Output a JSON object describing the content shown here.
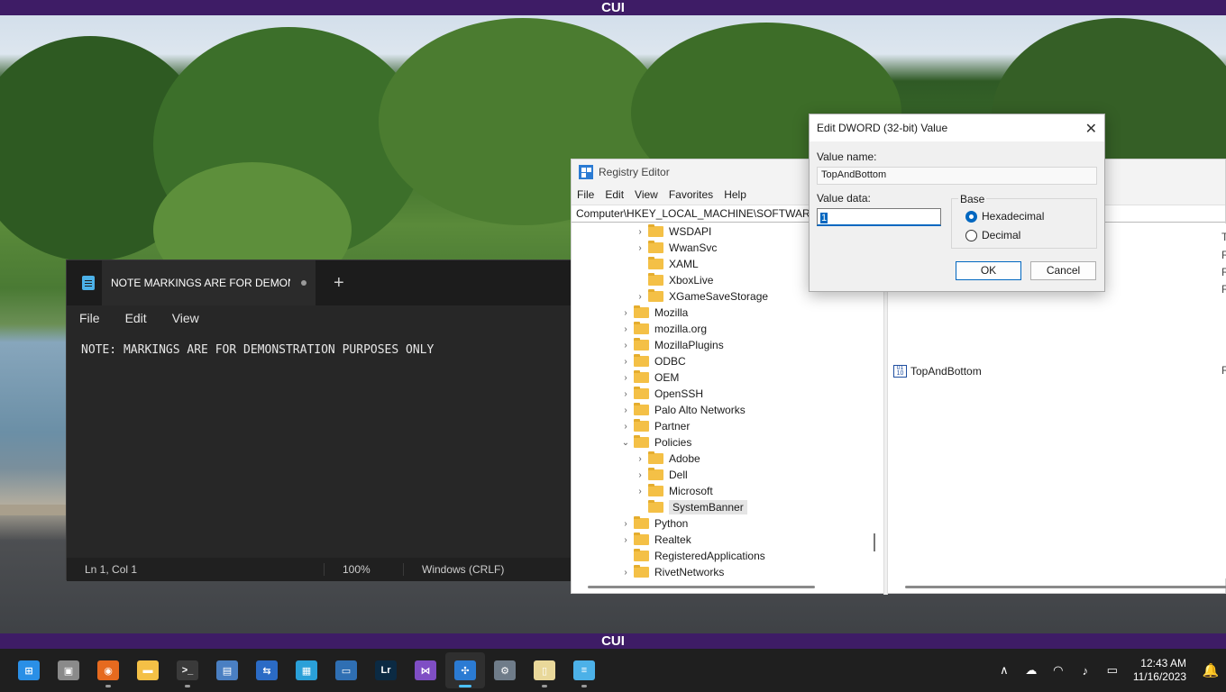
{
  "banner": {
    "top_text": "CUI",
    "bottom_text": "CUI"
  },
  "notepad": {
    "tab_title": "NOTE MARKINGS ARE FOR DEMON",
    "new_tab": "+",
    "menu": [
      "File",
      "Edit",
      "View"
    ],
    "content": "NOTE: MARKINGS ARE FOR DEMONSTRATION PURPOSES ONLY",
    "status": {
      "position": "Ln 1, Col 1",
      "zoom": "100%",
      "line_ending": "Windows (CRLF)"
    }
  },
  "regedit": {
    "title": "Registry Editor",
    "menu": [
      "File",
      "Edit",
      "View",
      "Favorites",
      "Help"
    ],
    "address": "Computer\\HKEY_LOCAL_MACHINE\\SOFTWARE\\",
    "tree": [
      {
        "label": "WSDAPI",
        "chevron": "›",
        "level": 2
      },
      {
        "label": "WwanSvc",
        "chevron": "›",
        "level": 2
      },
      {
        "label": "XAML",
        "chevron": "",
        "level": 2
      },
      {
        "label": "XboxLive",
        "chevron": "",
        "level": 2
      },
      {
        "label": "XGameSaveStorage",
        "chevron": "›",
        "level": 2
      },
      {
        "label": "Mozilla",
        "chevron": "›",
        "level": 1
      },
      {
        "label": "mozilla.org",
        "chevron": "›",
        "level": 1
      },
      {
        "label": "MozillaPlugins",
        "chevron": "›",
        "level": 1
      },
      {
        "label": "ODBC",
        "chevron": "›",
        "level": 1
      },
      {
        "label": "OEM",
        "chevron": "›",
        "level": 1
      },
      {
        "label": "OpenSSH",
        "chevron": "›",
        "level": 1
      },
      {
        "label": "Palo Alto Networks",
        "chevron": "›",
        "level": 1
      },
      {
        "label": "Partner",
        "chevron": "›",
        "level": 1
      },
      {
        "label": "Policies",
        "chevron": "⌄",
        "level": 1
      },
      {
        "label": "Adobe",
        "chevron": "›",
        "level": 2
      },
      {
        "label": "Dell",
        "chevron": "›",
        "level": 2
      },
      {
        "label": "Microsoft",
        "chevron": "›",
        "level": 2
      },
      {
        "label": "SystemBanner",
        "chevron": "",
        "level": 2,
        "selected": true
      },
      {
        "label": "Python",
        "chevron": "›",
        "level": 1
      },
      {
        "label": "Realtek",
        "chevron": "›",
        "level": 1
      },
      {
        "label": "RegisteredApplications",
        "chevron": "",
        "level": 1
      },
      {
        "label": "RivetNetworks",
        "chevron": "›",
        "level": 1
      }
    ],
    "values": [
      {
        "name": "TopAndBottom",
        "type": "R"
      }
    ],
    "type_header": "Ty",
    "type_col": [
      "R",
      "R",
      "R"
    ]
  },
  "dialog": {
    "title": "Edit DWORD (32-bit) Value",
    "close": "✕",
    "value_name_label": "Value name:",
    "value_name": "TopAndBottom",
    "value_data_label": "Value data:",
    "value_data": "1",
    "base_label": "Base",
    "hex_label": "Hexadecimal",
    "dec_label": "Decimal",
    "ok": "OK",
    "cancel": "Cancel"
  },
  "taskbar": {
    "apps": [
      {
        "name": "start",
        "color": "#2a8fe6",
        "glyph": "⊞",
        "running": false,
        "active": false
      },
      {
        "name": "task-view",
        "color": "#8a8a8a",
        "glyph": "▣",
        "running": false,
        "active": false
      },
      {
        "name": "firefox",
        "color": "#e66a1f",
        "glyph": "◉",
        "running": true,
        "active": false
      },
      {
        "name": "file-explorer",
        "color": "#f4c046",
        "glyph": "▬",
        "running": false,
        "active": false
      },
      {
        "name": "terminal",
        "color": "#3a3a3a",
        "glyph": ">_",
        "running": true,
        "active": false
      },
      {
        "name": "remote-desktop",
        "color": "#4a7fc2",
        "glyph": "▤",
        "running": false,
        "active": false
      },
      {
        "name": "network-tool",
        "color": "#2b6bc5",
        "glyph": "⇆",
        "running": false,
        "active": false
      },
      {
        "name": "building-app",
        "color": "#2aa0d8",
        "glyph": "▦",
        "running": false,
        "active": false
      },
      {
        "name": "photos",
        "color": "#2f6fb3",
        "glyph": "▭",
        "running": false,
        "active": false
      },
      {
        "name": "lightroom",
        "color": "#0b2a43",
        "glyph": "Lr",
        "running": false,
        "active": false
      },
      {
        "name": "visual-studio",
        "color": "#7f4ec4",
        "glyph": "⋈",
        "running": false,
        "active": false
      },
      {
        "name": "registry-editor",
        "color": "#2b7bd3",
        "glyph": "✣",
        "running": true,
        "active": true
      },
      {
        "name": "settings",
        "color": "#6f7c89",
        "glyph": "⚙",
        "running": false,
        "active": false
      },
      {
        "name": "notes",
        "color": "#e9d89a",
        "glyph": "▯",
        "running": true,
        "active": false
      },
      {
        "name": "notepad",
        "color": "#4cb1e8",
        "glyph": "≡",
        "running": true,
        "active": false
      }
    ],
    "tray": {
      "chevron": "∧",
      "cloud": "☁",
      "wifi": "◠",
      "volume": "♪",
      "battery": "▭"
    },
    "time": "12:43 AM",
    "date": "11/16/2023",
    "bell": "🔔"
  }
}
